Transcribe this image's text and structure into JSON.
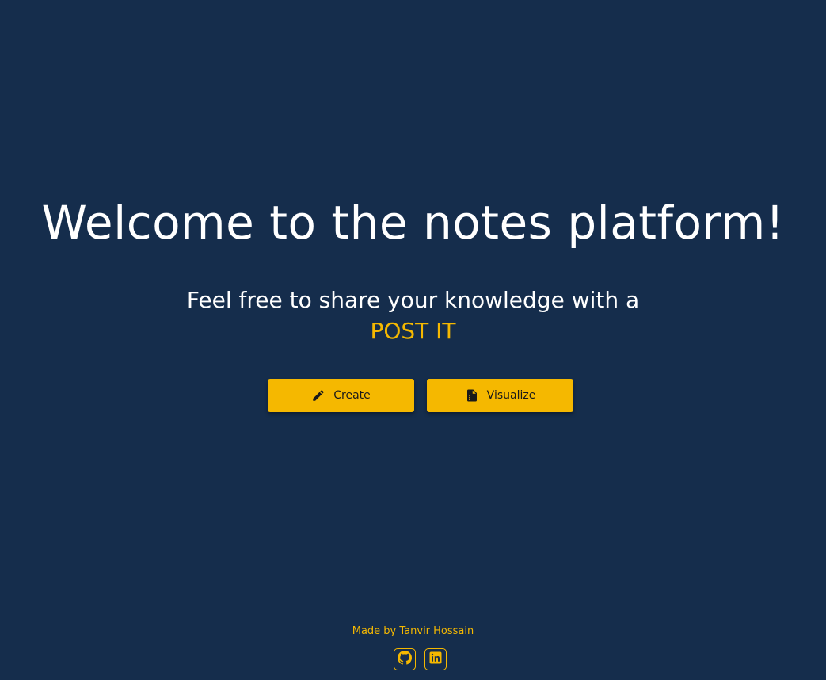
{
  "hero": {
    "title": "Welcome to the notes platform!",
    "subtitle": "Feel free to share your knowledge with a",
    "brand": "POST IT"
  },
  "actions": {
    "create_label": "Create",
    "create_icon": "pencil-icon",
    "visualize_label": "Visualize",
    "visualize_icon": "document-icon"
  },
  "footer": {
    "credit": "Made by Tanvir Hossain",
    "social": [
      {
        "icon": "github-icon"
      },
      {
        "icon": "linkedin-icon"
      }
    ]
  },
  "colors": {
    "background": "#152d4c",
    "accent": "#f5b800",
    "text": "#ffffff",
    "divider": "#6b6a58"
  }
}
